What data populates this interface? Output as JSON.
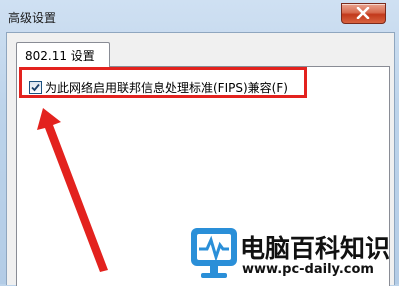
{
  "window": {
    "title": "高级设置"
  },
  "tabs": [
    {
      "label": "802.11 设置",
      "selected": true
    }
  ],
  "settings": {
    "fips_checkbox": {
      "label": "为此网络启用联邦信息处理标准(FIPS)兼容(F)",
      "checked": true
    }
  },
  "watermark": {
    "name": "电脑百科知识",
    "url": "www.pc-daily.com"
  },
  "colors": {
    "annotation_red": "#e3221e",
    "logo_blue": "#2a8fd8"
  },
  "icons": {
    "close": "close-icon",
    "check": "checkmark-icon",
    "logo": "monitor-logo-icon"
  }
}
